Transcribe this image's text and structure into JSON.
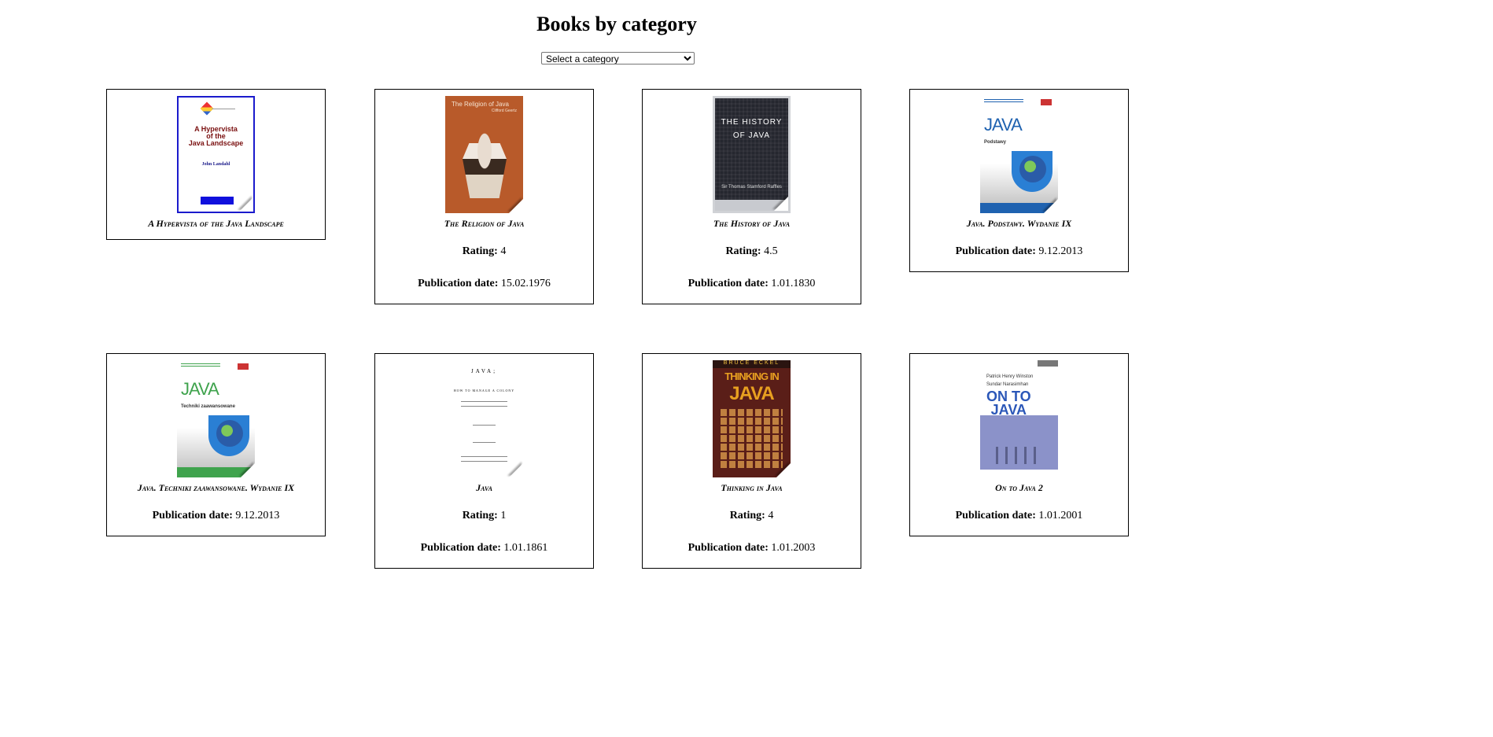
{
  "page": {
    "title": "Books by category",
    "category_select": {
      "selected": "Select a category"
    }
  },
  "labels": {
    "rating": "Rating:",
    "publication_date": "Publication date:"
  },
  "books": [
    {
      "title": "A Hypervista of the Java Landscape",
      "cover": {
        "title_line1": "A Hypervista",
        "title_line2": "of the",
        "title_line3": "Java Landscape",
        "author": "John Landahl"
      }
    },
    {
      "title": "The Religion of Java",
      "rating": "4",
      "publication_date": "15.02.1976",
      "cover": {
        "title": "The Religion of Java",
        "author": "Clifford Geertz"
      }
    },
    {
      "title": "The History of Java",
      "rating": "4.5",
      "publication_date": "1.01.1830",
      "cover": {
        "title_line1": "THE HISTORY",
        "title_line2": "OF JAVA",
        "author": "Sir Thomas Stamford Raffles"
      }
    },
    {
      "title": "Java. Podstawy. Wydanie IX",
      "publication_date": "9.12.2013",
      "cover": {
        "title": "JAVA",
        "subtitle": "Podstawy"
      }
    },
    {
      "title": "Java. Techniki zaawansowane. Wydanie IX",
      "publication_date": "9.12.2013",
      "cover": {
        "title": "JAVA",
        "subtitle": "Techniki zaawansowane"
      }
    },
    {
      "title": "Java",
      "rating": "1",
      "publication_date": "1.01.1861",
      "cover": {
        "title": "JAVA;",
        "subtitle": "HOW TO MANAGE A COLONY"
      }
    },
    {
      "title": "Thinking in Java",
      "rating": "4",
      "publication_date": "1.01.2003",
      "cover": {
        "header": "BRUCE ECKEL",
        "title_line1": "THINKING IN",
        "title_line2": "JAVA"
      }
    },
    {
      "title": "On to Java 2",
      "publication_date": "1.01.2001",
      "cover": {
        "author1": "Patrick Henry Winston",
        "author2": "Sundar Narasimhan",
        "title_line1": "ON TO",
        "title_line2": "JAVA"
      }
    }
  ]
}
